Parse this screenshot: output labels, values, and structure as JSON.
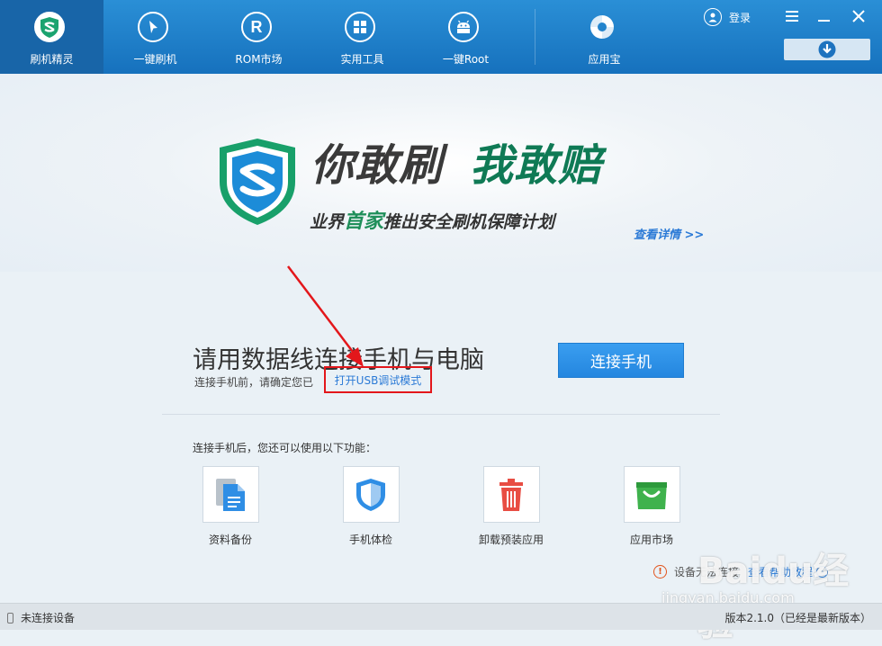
{
  "nav": [
    {
      "label": "刷机精灵",
      "icon": "shield-logo-icon",
      "active": true
    },
    {
      "label": "一键刷机",
      "icon": "cursor-arrow-icon",
      "active": false
    },
    {
      "label": "ROM市场",
      "icon": "rom-r-icon",
      "active": false
    },
    {
      "label": "实用工具",
      "icon": "grid-tools-icon",
      "active": false
    },
    {
      "label": "一键Root",
      "icon": "android-icon",
      "active": false
    },
    {
      "label": "应用宝",
      "icon": "app-store-icon",
      "active": false
    }
  ],
  "header": {
    "login_label": "登录"
  },
  "banner": {
    "slogan_part1": "你敢刷",
    "slogan_part2": "我敢赔",
    "subline_before": "业界",
    "subline_highlight": "首家",
    "subline_after": "推出安全刷机保障计划",
    "detail_link": "查看详情 >>"
  },
  "connect": {
    "title": "请用数据线连接手机与电脑",
    "sub_text": "连接手机前，请确定您已",
    "usb_link": "打开USB调试模式",
    "button": "连接手机"
  },
  "features": {
    "title": "连接手机后，您还可以使用以下功能：",
    "items": [
      {
        "label": "资料备份",
        "icon": "document-backup-icon"
      },
      {
        "label": "手机体检",
        "icon": "shield-check-icon"
      },
      {
        "label": "卸载预装应用",
        "icon": "trash-icon"
      },
      {
        "label": "应用市场",
        "icon": "shopping-bag-icon"
      }
    ]
  },
  "warning": {
    "text": "设备无法连接",
    "link": "查看帮助教程"
  },
  "watermark": {
    "logo": "Baidu经验",
    "url": "jingyan.baidu.com"
  },
  "status": {
    "left": "未连接设备",
    "right": "版本2.1.0（已经是最新版本）"
  },
  "colors": {
    "topbar": "#1e7ccb",
    "accent": "#2b7ad6",
    "connect_button": "#2b8ee6",
    "annotation": "#e3171b",
    "brand_green": "#1f8f5a"
  }
}
